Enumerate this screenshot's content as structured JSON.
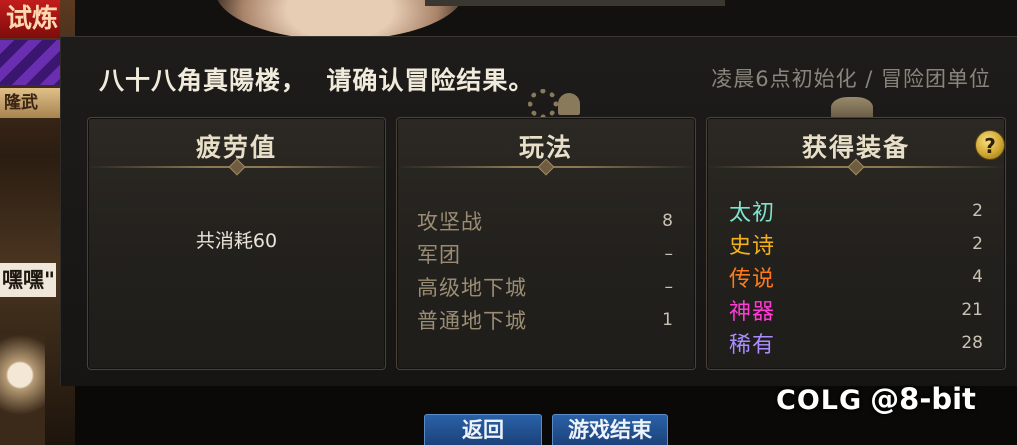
{
  "background": {
    "left_tag": "试炼",
    "left_sign": "隆武",
    "left_speech": "嘿嘿\""
  },
  "dialog": {
    "title": "八十八角真陽楼，  请确认冒险结果。",
    "reset_note": "凌晨6点初始化 / 冒险团单位"
  },
  "fatigue": {
    "heading": "疲劳值",
    "text": "共消耗60"
  },
  "content": {
    "heading": "玩法",
    "rows": [
      {
        "label": "攻坚战",
        "value": "8"
      },
      {
        "label": "军团",
        "value": "–"
      },
      {
        "label": "高级地下城",
        "value": "–"
      },
      {
        "label": "普通地下城",
        "value": "1"
      }
    ]
  },
  "loot": {
    "heading": "获得装备",
    "help_icon": "?",
    "rows": [
      {
        "label": "太初",
        "value": "2",
        "color": "#7fe3cf"
      },
      {
        "label": "史诗",
        "value": "2",
        "color": "#f3b21c"
      },
      {
        "label": "传说",
        "value": "4",
        "color": "#ff7a1a"
      },
      {
        "label": "神器",
        "value": "21",
        "color": "#ff3ad6"
      },
      {
        "label": "稀有",
        "value": "28",
        "color": "#a98cff"
      }
    ]
  },
  "buttons": {
    "back": "返回",
    "end_game": "游戏结束"
  },
  "watermark": {
    "brand": "COLG",
    "handle": "@8-bit"
  }
}
